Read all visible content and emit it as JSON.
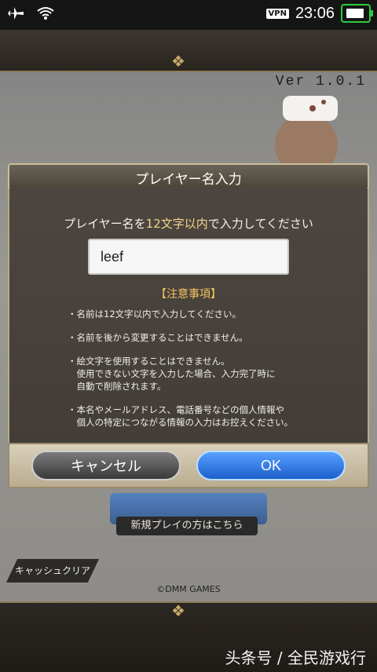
{
  "status_bar": {
    "icons": [
      "airplane-icon",
      "wifi-icon"
    ],
    "vpn_label": "VPN",
    "time": "23:06"
  },
  "game": {
    "version": "Ver 1.0.1",
    "new_player_text": "新規プレイの方はこちら",
    "cache_clear_label": "キャッシュクリア",
    "copyright": "©DMM GAMES"
  },
  "dialog": {
    "title": "プレイヤー名入力",
    "instruction_prefix": "プレイヤー名を",
    "instruction_highlight": "12文字以内",
    "instruction_suffix": "で入力してください",
    "input_value": "leef",
    "notes_title": "【注意事項】",
    "notes": [
      "・名前は12文字以内で入力してください。",
      "・名前を後から変更することはできません。",
      "・絵文字を使用することはできません。\n　使用できない文字を入力した場合、入力完了時に\n　自動で削除されます。",
      "・本名やメールアドレス、電話番号などの個人情報や\n　個人の特定につながる情報の入力はお控えください。"
    ],
    "cancel_label": "キャンセル",
    "ok_label": "OK"
  },
  "watermark": "头条号 / 全民游戏行"
}
